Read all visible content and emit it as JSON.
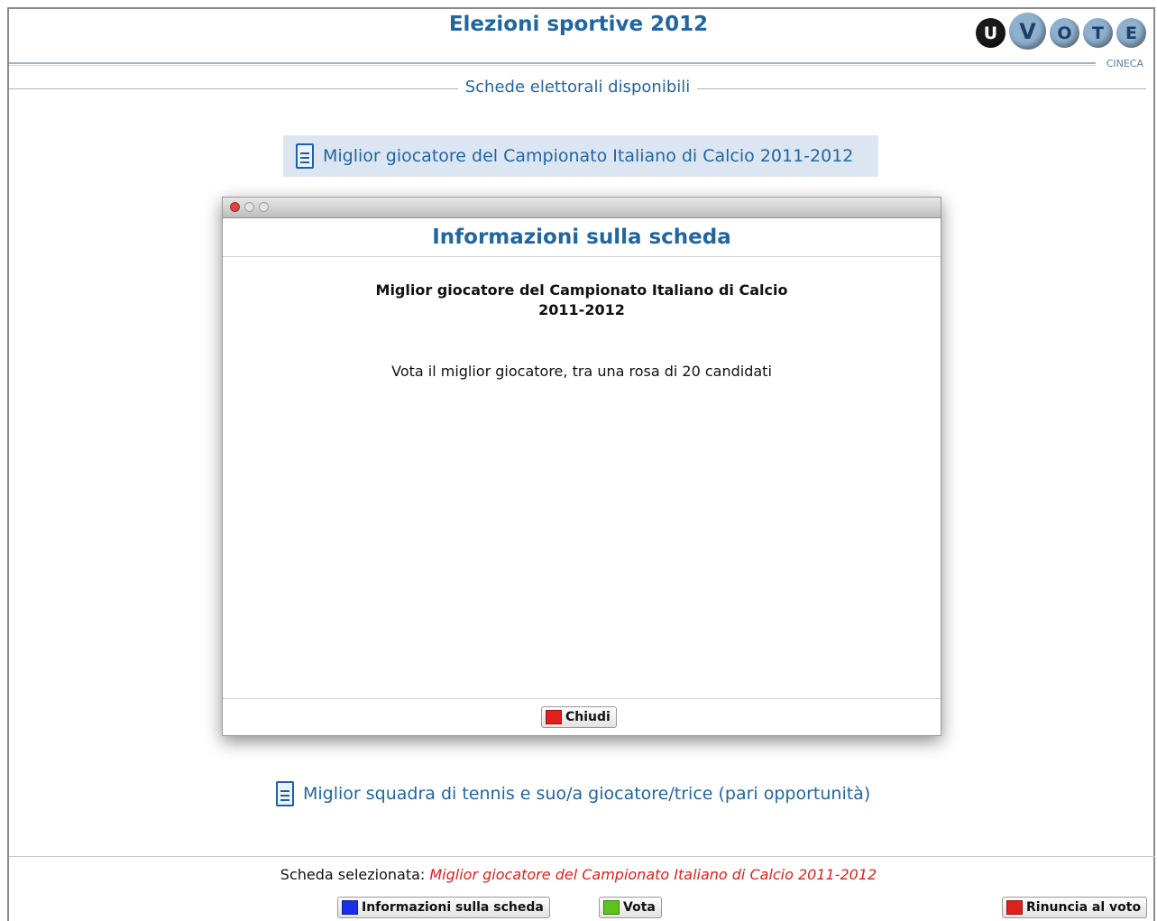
{
  "header": {
    "title": "Elezioni sportive 2012",
    "logo_letters": [
      "U",
      "V",
      "O",
      "T",
      "E"
    ],
    "logo_caption": "CINECA"
  },
  "section_title": "Schede elettorali disponibili",
  "ballots": [
    {
      "label": "Miglior giocatore del Campionato Italiano di Calcio 2011-2012",
      "selected": true
    },
    {
      "label": "Miglior squadra di tennis e suo/a giocatore/trice (pari opportunità)",
      "selected": false
    }
  ],
  "dialog": {
    "heading": "Informazioni sulla scheda",
    "ballot_name_line1": "Miglior giocatore del Campionato Italiano di Calcio",
    "ballot_name_line2": "2011-2012",
    "description": "Vota il miglior giocatore, tra una rosa di 20 candidati",
    "close_label": "Chiudi"
  },
  "footer": {
    "selected_prefix": "Scheda selezionata:",
    "selected_value": "Miglior giocatore del Campionato Italiano di Calcio 2011-2012",
    "info_label": "Informazioni sulla scheda",
    "vote_label": "Vota",
    "renounce_label": "Rinuncia al voto"
  },
  "colors": {
    "accent_blue": "#2266a0",
    "selected_text": "#e0201a",
    "info_swatch": "#1a2ee8",
    "vote_swatch": "#5ec21a",
    "renounce_swatch": "#e0201a",
    "close_swatch": "#e0201a"
  },
  "icons": {
    "ballot": "document-icon"
  }
}
